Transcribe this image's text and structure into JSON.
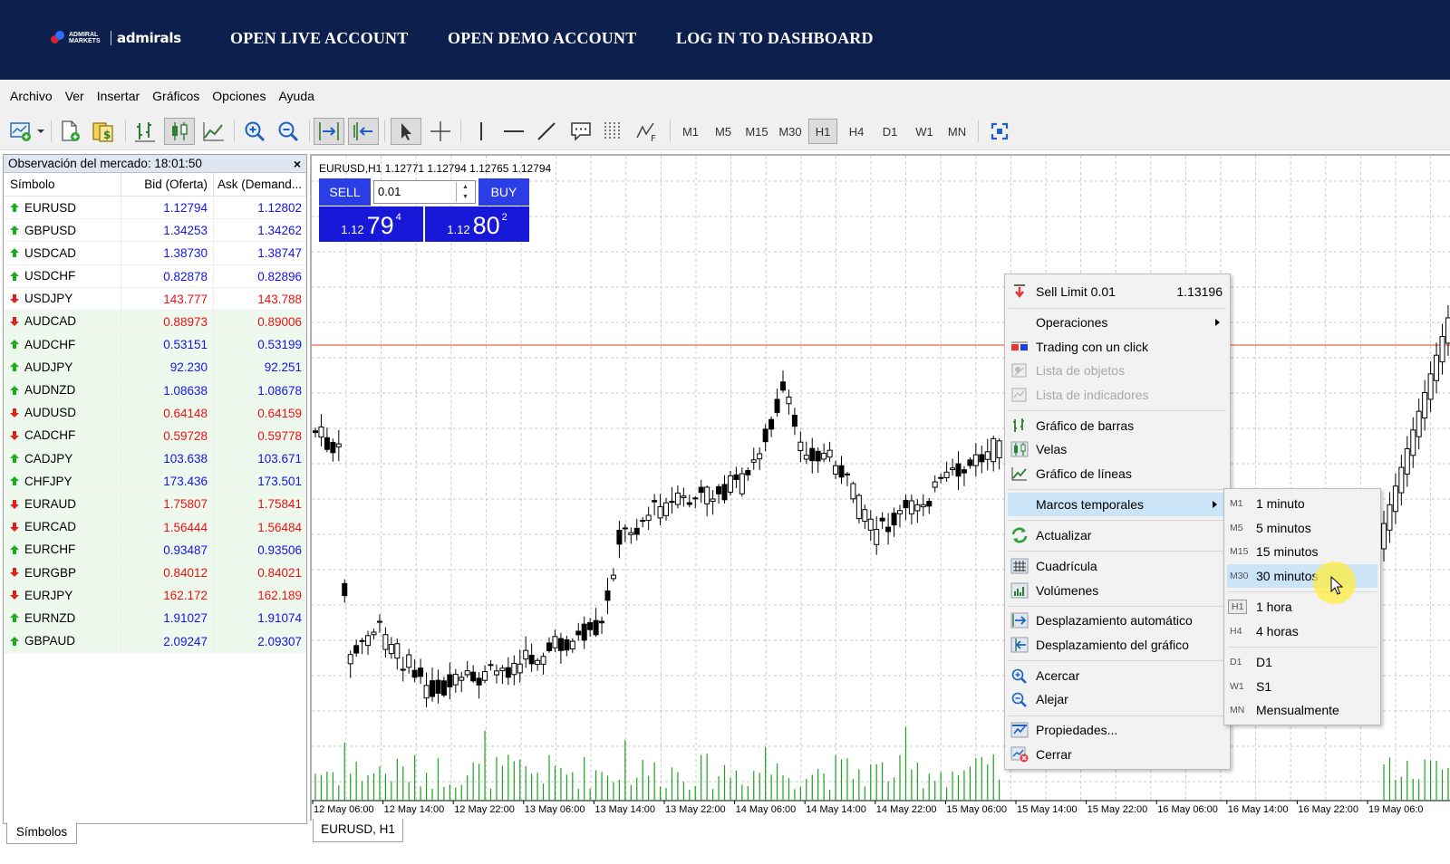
{
  "header": {
    "logo": {
      "small_line1": "ADMIRAL",
      "small_line2": "MARKETS",
      "brand": "admirals"
    },
    "links": [
      "OPEN LIVE ACCOUNT",
      "OPEN DEMO ACCOUNT",
      "LOG IN TO DASHBOARD"
    ]
  },
  "menu": [
    "Archivo",
    "Ver",
    "Insertar",
    "Gráficos",
    "Opciones",
    "Ayuda"
  ],
  "timeframes": [
    "M1",
    "M5",
    "M15",
    "M30",
    "H1",
    "H4",
    "D1",
    "W1",
    "MN"
  ],
  "active_timeframe": "H1",
  "market_watch": {
    "title": "Observación del mercado: 18:01:50",
    "close": "×",
    "columns": [
      "Símbolo",
      "Bid (Oferta)",
      "Ask (Demand..."
    ],
    "rows": [
      {
        "symbol": "EURUSD",
        "bid": "1.12794",
        "ask": "1.12802",
        "dir": "up"
      },
      {
        "symbol": "GBPUSD",
        "bid": "1.34253",
        "ask": "1.34262",
        "dir": "up"
      },
      {
        "symbol": "USDCAD",
        "bid": "1.38730",
        "ask": "1.38747",
        "dir": "up"
      },
      {
        "symbol": "USDCHF",
        "bid": "0.82878",
        "ask": "0.82896",
        "dir": "up"
      },
      {
        "symbol": "USDJPY",
        "bid": "143.777",
        "ask": "143.788",
        "dir": "down"
      },
      {
        "symbol": "AUDCAD",
        "bid": "0.88973",
        "ask": "0.89006",
        "dir": "down"
      },
      {
        "symbol": "AUDCHF",
        "bid": "0.53151",
        "ask": "0.53199",
        "dir": "up"
      },
      {
        "symbol": "AUDJPY",
        "bid": "92.230",
        "ask": "92.251",
        "dir": "up"
      },
      {
        "symbol": "AUDNZD",
        "bid": "1.08638",
        "ask": "1.08678",
        "dir": "up"
      },
      {
        "symbol": "AUDUSD",
        "bid": "0.64148",
        "ask": "0.64159",
        "dir": "down"
      },
      {
        "symbol": "CADCHF",
        "bid": "0.59728",
        "ask": "0.59778",
        "dir": "down"
      },
      {
        "symbol": "CADJPY",
        "bid": "103.638",
        "ask": "103.671",
        "dir": "up"
      },
      {
        "symbol": "CHFJPY",
        "bid": "173.436",
        "ask": "173.501",
        "dir": "up"
      },
      {
        "symbol": "EURAUD",
        "bid": "1.75807",
        "ask": "1.75841",
        "dir": "down"
      },
      {
        "symbol": "EURCAD",
        "bid": "1.56444",
        "ask": "1.56484",
        "dir": "down"
      },
      {
        "symbol": "EURCHF",
        "bid": "0.93487",
        "ask": "0.93506",
        "dir": "up"
      },
      {
        "symbol": "EURGBP",
        "bid": "0.84012",
        "ask": "0.84021",
        "dir": "down"
      },
      {
        "symbol": "EURJPY",
        "bid": "162.172",
        "ask": "162.189",
        "dir": "down"
      },
      {
        "symbol": "EURNZD",
        "bid": "1.91027",
        "ask": "1.91074",
        "dir": "up"
      },
      {
        "symbol": "GBPAUD",
        "bid": "2.09247",
        "ask": "2.09307",
        "dir": "up"
      }
    ],
    "tab": "Símbolos"
  },
  "chart": {
    "info": "EURUSD,H1  1.12771 1.12794 1.12765 1.12794",
    "sell_label": "SELL",
    "buy_label": "BUY",
    "volume": "0.01",
    "sell_price": {
      "prefix": "1.12",
      "big": "79",
      "sup": "4"
    },
    "buy_price": {
      "prefix": "1.12",
      "big": "80",
      "sup": "2"
    },
    "tab": "EURUSD, H1",
    "x_labels": [
      "12 May 06:00",
      "12 May 14:00",
      "12 May 22:00",
      "13 May 06:00",
      "13 May 14:00",
      "13 May 22:00",
      "14 May 06:00",
      "14 May 14:00",
      "14 May 22:00",
      "15 May 06:00",
      "15 May 14:00",
      "15 May 22:00",
      "16 May 06:00",
      "16 May 14:00",
      "16 May 22:00",
      "19 May 06:0"
    ],
    "colors": {
      "bg": "#ffffff",
      "grid": "#c8c8c8",
      "candle": "#000000",
      "volume": "#1aa21a",
      "level_line": "#f08060"
    }
  },
  "context_menu": {
    "items": [
      {
        "label": "Sell Limit 0.01",
        "value": "1.13196",
        "icon": "sell-limit-icon"
      },
      {
        "label": "Operaciones",
        "submenu": true
      },
      {
        "label": "Trading con un click",
        "icon": "one-click-icon"
      },
      {
        "label": "Lista de objetos",
        "disabled": true,
        "icon": "objects-list-icon"
      },
      {
        "label": "Lista de indicadores",
        "disabled": true,
        "icon": "indicators-list-icon"
      },
      {
        "label": "Gráfico de barras",
        "icon": "bar-chart-icon"
      },
      {
        "label": "Velas",
        "icon": "candles-icon"
      },
      {
        "label": "Gráfico de líneas",
        "icon": "line-chart-icon"
      },
      {
        "label": "Marcos temporales",
        "submenu": true,
        "highlighted": true
      },
      {
        "label": "Actualizar",
        "icon": "refresh-icon"
      },
      {
        "label": "Cuadrícula",
        "icon": "grid-icon"
      },
      {
        "label": "Volúmenes",
        "icon": "volumes-icon"
      },
      {
        "label": "Desplazamiento automático",
        "icon": "autoscroll-icon"
      },
      {
        "label": "Desplazamiento del gráfico",
        "icon": "chart-shift-icon"
      },
      {
        "label": "Acercar",
        "icon": "zoom-in-icon"
      },
      {
        "label": "Alejar",
        "icon": "zoom-out-icon"
      },
      {
        "label": "Propiedades...",
        "icon": "properties-icon"
      },
      {
        "label": "Cerrar",
        "icon": "close-chart-icon"
      }
    ]
  },
  "timeframe_menu": {
    "items": [
      {
        "code": "M1",
        "label": "1 minuto"
      },
      {
        "code": "M5",
        "label": "5 minutos"
      },
      {
        "code": "M15",
        "label": "15 minutos"
      },
      {
        "code": "M30",
        "label": "30 minutos",
        "highlighted": true
      },
      {
        "code": "H1",
        "label": "1 hora",
        "checked": true
      },
      {
        "code": "H4",
        "label": "4 horas"
      },
      {
        "code": "D1",
        "label": "D1"
      },
      {
        "code": "W1",
        "label": "S1"
      },
      {
        "code": "MN",
        "label": "Mensualmente"
      }
    ]
  }
}
